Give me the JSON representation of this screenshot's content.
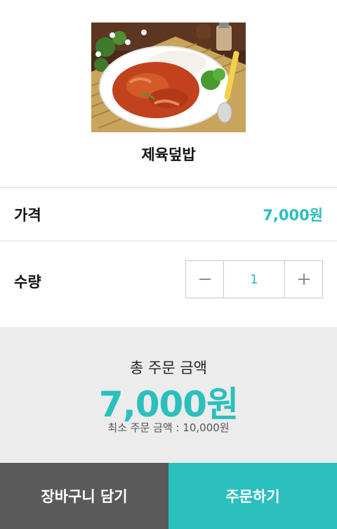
{
  "product": {
    "name": "제육덮밥",
    "image_alt": "food-photo"
  },
  "price": {
    "label": "가격",
    "value": "7,000원"
  },
  "quantity": {
    "label": "수량",
    "value": "1",
    "decrease_icon": "minus-icon",
    "increase_icon": "plus-icon"
  },
  "total": {
    "label": "총 주문 금액",
    "amount": "7,000원",
    "min_order": "최소 주문 금액 : 10,000원"
  },
  "actions": {
    "cart_label": "장바구니 담기",
    "order_label": "주문하기"
  },
  "colors": {
    "accent": "#2bbfbd",
    "cart_button": "#5a5a5a",
    "summary_bg": "#ececec"
  }
}
